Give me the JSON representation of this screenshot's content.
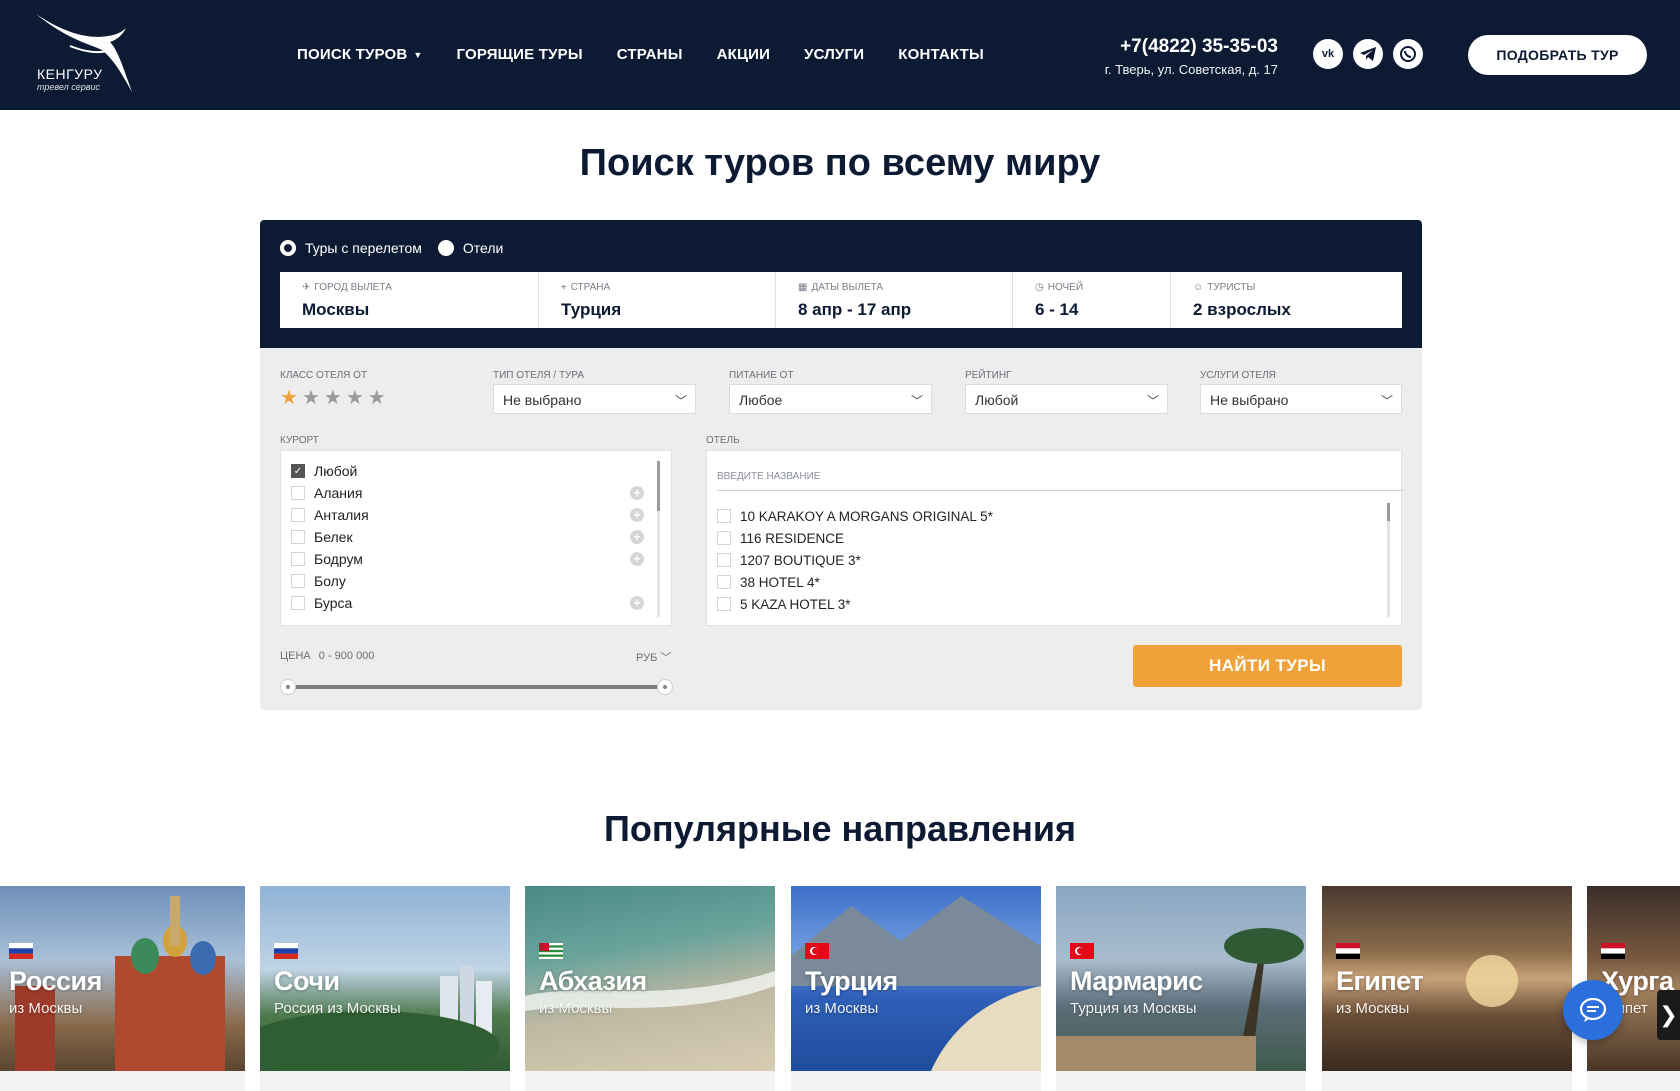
{
  "header": {
    "logo_text": "КЕНГУРУ",
    "logo_sub": "тревел сервис",
    "nav": [
      {
        "label": "ПОИСК ТУРОВ",
        "has_dropdown": true
      },
      {
        "label": "ГОРЯЩИЕ ТУРЫ"
      },
      {
        "label": "СТРАНЫ"
      },
      {
        "label": "АКЦИИ"
      },
      {
        "label": "УСЛУГИ"
      },
      {
        "label": "КОНТАКТЫ"
      }
    ],
    "phone": "+7(4822) 35-35-03",
    "address": "г. Тверь, ул. Советская, д. 17",
    "socials": [
      "vk-icon",
      "telegram-icon",
      "whatsapp-icon"
    ],
    "cta_label": "ПОДОБРАТЬ ТУР"
  },
  "search": {
    "title": "Поиск туров по всему миру",
    "modes": [
      {
        "label": "Туры с перелетом",
        "selected": true
      },
      {
        "label": "Отели",
        "selected": false
      }
    ],
    "fields": [
      {
        "label": "ГОРОД ВЫЛЕТА",
        "value": "Москвы",
        "icon": "plane-icon"
      },
      {
        "label": "СТРАНА",
        "value": "Турция",
        "icon": "pin-icon"
      },
      {
        "label": "ДАТЫ ВЫЛЕТА",
        "value": "8 апр - 17 апр",
        "icon": "calendar-icon"
      },
      {
        "label": "НОЧЕЙ",
        "value": "6 - 14",
        "icon": "clock-icon"
      },
      {
        "label": "ТУРИСТЫ",
        "value": "2 взрослых",
        "icon": "user-icon"
      }
    ],
    "hotel_class": {
      "label": "КЛАСС ОТЕЛЯ ОТ",
      "stars_total": 5,
      "stars_selected": 1
    },
    "filters": [
      {
        "label": "ТИП ОТЕЛЯ / ТУРА",
        "value": "Не выбрано"
      },
      {
        "label": "ПИТАНИЕ ОТ",
        "value": "Любое"
      },
      {
        "label": "РЕЙТИНГ",
        "value": "Любой"
      },
      {
        "label": "УСЛУГИ ОТЕЛЯ",
        "value": "Не выбрано"
      }
    ],
    "resort": {
      "label": "КУРОРТ",
      "items": [
        {
          "label": "Любой",
          "checked": true,
          "expandable": false
        },
        {
          "label": "Алания",
          "checked": false,
          "expandable": true
        },
        {
          "label": "Анталия",
          "checked": false,
          "expandable": true
        },
        {
          "label": "Белек",
          "checked": false,
          "expandable": true
        },
        {
          "label": "Бодрум",
          "checked": false,
          "expandable": true
        },
        {
          "label": "Болу",
          "checked": false,
          "expandable": false
        },
        {
          "label": "Бурса",
          "checked": false,
          "expandable": true
        }
      ]
    },
    "hotel": {
      "label": "ОТЕЛЬ",
      "placeholder": "ВВЕДИТЕ НАЗВАНИЕ",
      "items": [
        "10 KARAKOY A MORGANS ORIGINAL 5*",
        "116 RESIDENCE",
        "1207 BOUTIQUE 3*",
        "38 HOTEL 4*",
        "5 KAZA HOTEL 3*"
      ]
    },
    "price": {
      "label": "ЦЕНА",
      "range_text": "0 -  900 000",
      "min": 0,
      "max": 900000,
      "currency": "РУБ"
    },
    "submit_label": "НАЙТИ ТУРЫ"
  },
  "popular": {
    "title": "Популярные направления",
    "cards": [
      {
        "title": "Россия",
        "sub": "из Москвы",
        "flag": "ru",
        "bg": "moscow"
      },
      {
        "title": "Сочи",
        "sub": "Россия из Москвы",
        "flag": "ru",
        "bg": "sochi"
      },
      {
        "title": "Абхазия",
        "sub": "из Москвы",
        "flag": "abkhazia",
        "bg": "beach"
      },
      {
        "title": "Турция",
        "sub": "из Москвы",
        "flag": "tr",
        "bg": "bay"
      },
      {
        "title": "Мармарис",
        "sub": "Турция из Москвы",
        "flag": "tr",
        "bg": "resort"
      },
      {
        "title": "Египет",
        "sub": "из Москвы",
        "flag": "eg",
        "bg": "sunset"
      },
      {
        "title": "Хурга",
        "sub": "Египет",
        "flag": "eg",
        "bg": "sunset2"
      }
    ]
  },
  "colors": {
    "navy": "#0d1a33",
    "accent": "#f0a23a",
    "panel": "#ededed",
    "chat": "#2a6fdb"
  }
}
